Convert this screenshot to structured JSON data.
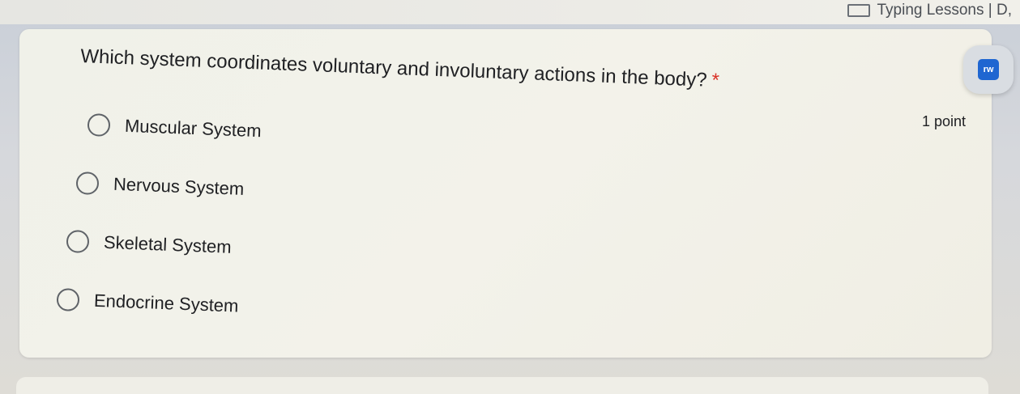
{
  "browser": {
    "bookmark_label": "Typing Lessons | D,"
  },
  "question": {
    "title": "Which system coordinates voluntary and involuntary actions in the body?",
    "required_marker": "*",
    "points_label": "1 point",
    "options": [
      {
        "label": "Muscular System"
      },
      {
        "label": "Nervous System"
      },
      {
        "label": "Skeletal System"
      },
      {
        "label": "Endocrine System"
      }
    ]
  },
  "extension": {
    "icon_text": "rw"
  },
  "colors": {
    "required": "#d93025",
    "text": "#202124",
    "radio_border": "#5f6368",
    "extension_blue": "#1f66d1"
  }
}
